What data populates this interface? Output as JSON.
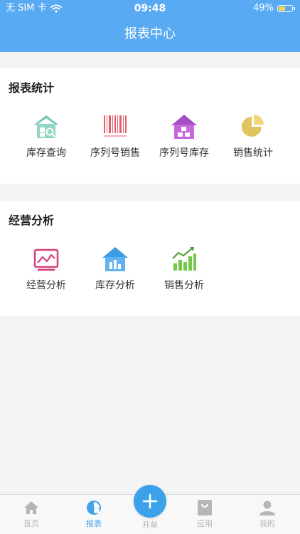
{
  "status_bar": {
    "carrier": "无 SIM 卡",
    "time": "09:48",
    "battery": "49%",
    "battery_level": 0.49
  },
  "header": {
    "title": "报表中心"
  },
  "sections": [
    {
      "title": "报表统计",
      "items": [
        {
          "label": "库存查询",
          "icon": "warehouse-search-icon"
        },
        {
          "label": "序列号销售",
          "icon": "barcode-icon"
        },
        {
          "label": "序列号库存",
          "icon": "house-icon"
        },
        {
          "label": "销售统计",
          "icon": "pie-chart-icon"
        }
      ]
    },
    {
      "title": "经营分析",
      "items": [
        {
          "label": "经营分析",
          "icon": "analysis-chart-icon"
        },
        {
          "label": "库存分析",
          "icon": "inventory-chart-icon"
        },
        {
          "label": "销售分析",
          "icon": "sales-trend-icon"
        }
      ]
    }
  ],
  "tabbar": {
    "home": "首页",
    "reports": "报表",
    "create": "开单",
    "apps": "应用",
    "mine": "我的"
  },
  "colors": {
    "header": "#58aaf3",
    "accent": "#3ba2ea",
    "tab_active": "#45a3e8",
    "tab_inactive": "#b6b6b6"
  }
}
